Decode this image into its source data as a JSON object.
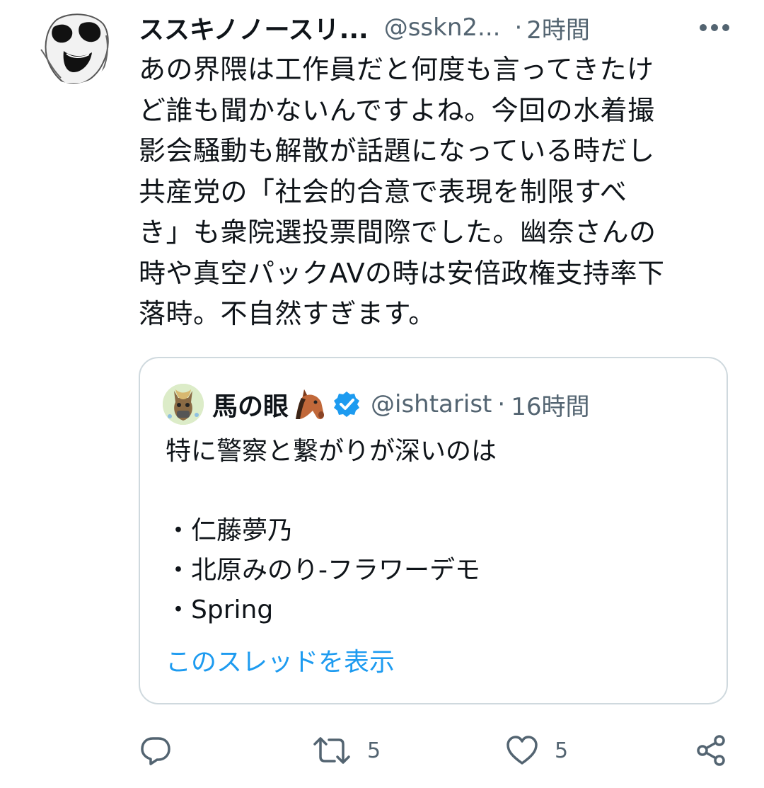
{
  "tweet": {
    "author": {
      "display_name": "ススキノノースリ...",
      "handle": "@sskn2...",
      "avatar_icon": "mask-face-avatar"
    },
    "separator": "·",
    "time": "2時間",
    "more_icon": "more-horizontal-icon",
    "text_lines": [
      "あの界隈は工作員だと何度も言ってきたけ",
      "ど誰も聞かないんですよね。今回の水着撮",
      "影会騒動も解散が話題になっている時だし",
      "共産党の「社会的合意で表現を制限すべ",
      "き」も衆院選投票間際でした。幽奈さんの",
      "時や真空パックAVの時は安倍政権支持率下",
      "落時。不自然すぎます。"
    ]
  },
  "quoted_tweet": {
    "display_name": "馬の眼",
    "name_emoji_icon": "horse-face-icon",
    "verified_icon": "verified-badge-icon",
    "handle": "@ishtarist",
    "separator": "·",
    "time": "16時間",
    "text_lines": [
      "特に警察と繋がりが深いのは",
      "",
      "・仁藤夢乃",
      "・北原みのり-フラワーデモ",
      "・Spring"
    ],
    "show_thread": "このスレッドを表示"
  },
  "actions": {
    "reply": {
      "icon": "reply-icon",
      "count": ""
    },
    "retweet": {
      "icon": "retweet-icon",
      "count": "5"
    },
    "like": {
      "icon": "heart-icon",
      "count": "5"
    },
    "share": {
      "icon": "share-icon",
      "count": ""
    }
  },
  "colors": {
    "text_primary": "#0f1419",
    "text_secondary": "#536471",
    "link": "#1d9bf0",
    "border": "#cfd9de",
    "verified": "#1d9bf0"
  }
}
